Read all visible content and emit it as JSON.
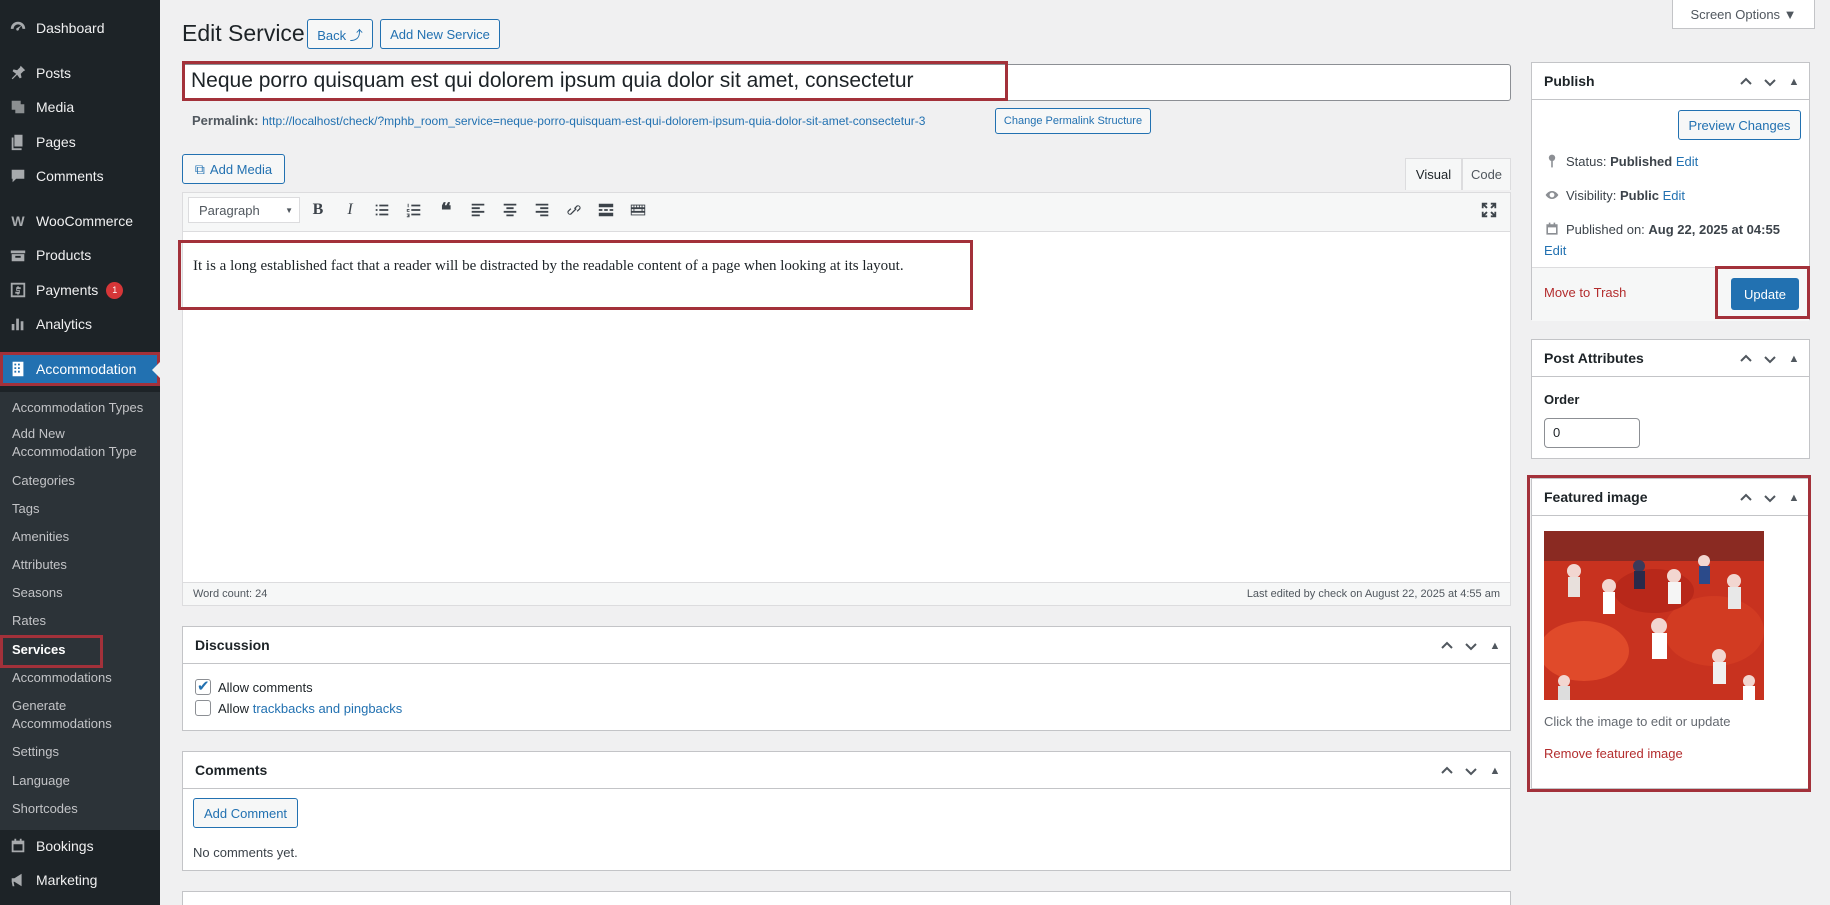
{
  "sidebar": {
    "menu": [
      {
        "label": "Dashboard",
        "icon": "dashboard-icon"
      },
      {
        "label": "Posts",
        "icon": "pin-icon"
      },
      {
        "label": "Media",
        "icon": "media-icon"
      },
      {
        "label": "Pages",
        "icon": "pages-icon"
      },
      {
        "label": "Comments",
        "icon": "comments-icon"
      },
      {
        "label": "WooCommerce",
        "icon": "woocommerce-icon"
      },
      {
        "label": "Products",
        "icon": "products-icon"
      },
      {
        "label": "Payments",
        "icon": "payments-icon",
        "badge": "1"
      },
      {
        "label": "Analytics",
        "icon": "analytics-icon"
      },
      {
        "label": "Accommodation",
        "icon": "building-icon"
      },
      {
        "label": "Bookings",
        "icon": "calendar-icon"
      },
      {
        "label": "Marketing",
        "icon": "megaphone-icon"
      }
    ],
    "submenu": [
      "Accommodation Types",
      "Add New",
      "Accommodation Type",
      "Categories",
      "Tags",
      "Amenities",
      "Attributes",
      "Seasons",
      "Rates",
      "Services",
      "Accommodations",
      "Generate",
      "Accommodations",
      "Settings",
      "Language",
      "Shortcodes"
    ]
  },
  "header": {
    "title": "Edit Service",
    "back_label": "Back ⤴",
    "add_new_label": "Add New Service",
    "screen_options": "Screen Options ▼"
  },
  "post": {
    "title": "Neque porro quisquam est qui dolorem ipsum quia dolor sit amet, consectetur",
    "permalink_label": "Permalink:",
    "permalink_url": "http://localhost/check/?mphb_room_service=neque-porro-quisquam-est-qui-dolorem-ipsum-quia-dolor-sit-amet-consectetur-3",
    "change_permalink": "Change Permalink Structure"
  },
  "editor": {
    "add_media": "Add Media",
    "tab_visual": "Visual",
    "tab_code": "Code",
    "format": "Paragraph",
    "content": "It is a long established fact that a reader will be distracted by the readable content of a page when looking at its layout.",
    "word_count": "Word count: 24",
    "last_edited": "Last edited by check on August 22, 2025 at 4:55 am"
  },
  "discussion": {
    "title": "Discussion",
    "allow_comments": "Allow comments",
    "allow_prefix": "Allow",
    "trackbacks": "trackbacks and pingbacks"
  },
  "comments": {
    "title": "Comments",
    "add_comment": "Add Comment",
    "empty": "No comments yet."
  },
  "publish": {
    "title": "Publish",
    "preview": "Preview Changes",
    "status_label": "Status:",
    "status_value": "Published",
    "visibility_label": "Visibility:",
    "visibility_value": "Public",
    "published_label": "Published on:",
    "published_value": "Aug 22, 2025 at 04:55",
    "edit": "Edit",
    "trash": "Move to Trash",
    "update": "Update"
  },
  "attributes": {
    "title": "Post Attributes",
    "order_label": "Order",
    "order_value": "0"
  },
  "featured": {
    "title": "Featured image",
    "hint": "Click the image to edit or update",
    "remove": "Remove featured image"
  },
  "colors": {
    "accent": "#2271b1",
    "highlight": "#a3313a",
    "sidebar": "#1d2327"
  }
}
